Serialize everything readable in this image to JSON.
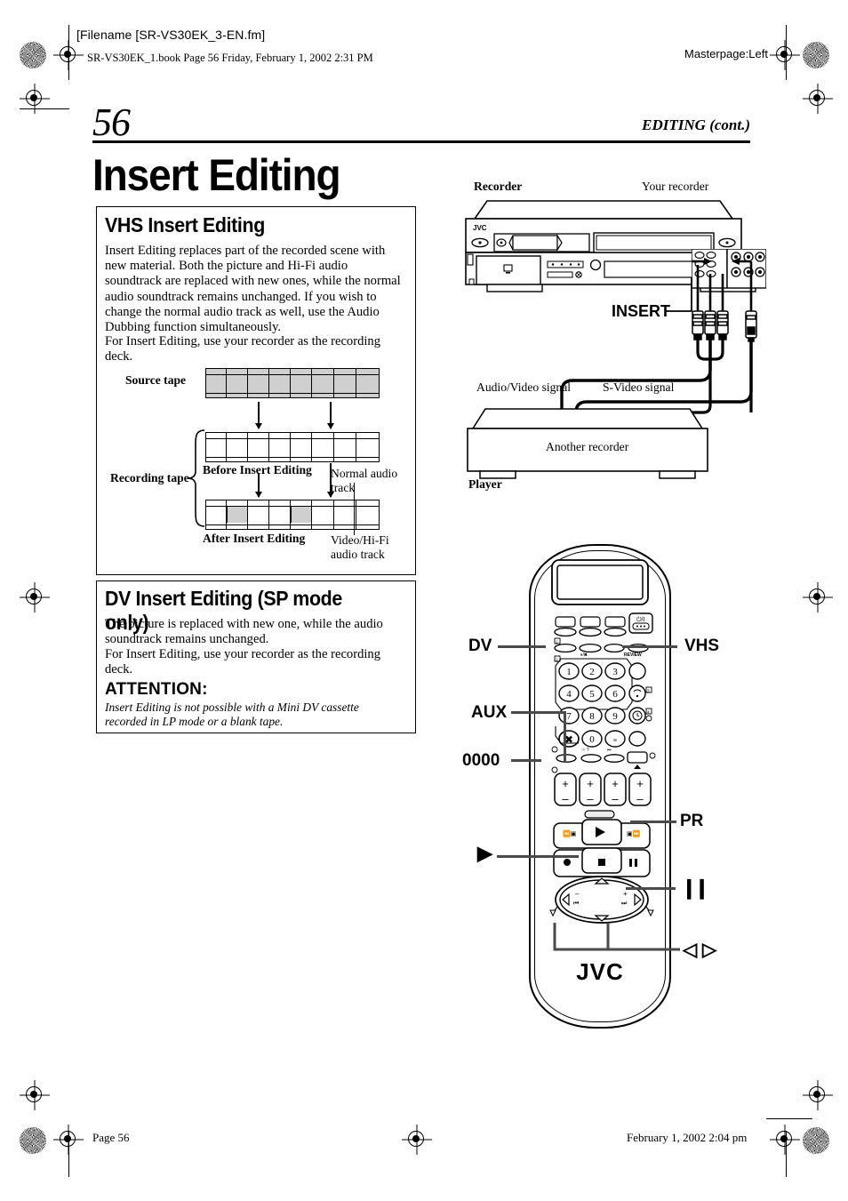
{
  "header": {
    "filename_line": "[Filename [SR-VS30EK_3-EN.fm]",
    "book_line": "SR-VS30EK_1.book  Page 56  Friday, February 1, 2002  2:31 PM",
    "masterpage": "Masterpage:Left"
  },
  "page": {
    "number": "56",
    "running_head": "EDITING (cont.)",
    "title": "Insert Editing"
  },
  "vhs_section": {
    "heading": "VHS Insert Editing",
    "paragraph": "Insert Editing replaces part of the recorded scene with new material. Both the picture and Hi-Fi audio soundtrack are replaced with new ones, while the normal audio soundtrack remains unchanged. If you wish to change the normal audio track as well, use the Audio Dubbing function simultaneously.",
    "paragraph2": "For Insert Editing, use your recorder as the recording deck."
  },
  "tape_diagram": {
    "source_tape_label": "Source tape",
    "recording_tape_label": "Recording tape",
    "before_label": "Before Insert Editing",
    "after_label": "After Insert Editing",
    "normal_audio_label_line1": "Normal audio",
    "normal_audio_label_line2": "track",
    "video_hifi_label_line1": "Video/Hi-Fi",
    "video_hifi_label_line2": "audio track",
    "source_cells_shaded": [
      true,
      true,
      true,
      true,
      true,
      true,
      true,
      true
    ],
    "before_cells_shaded": [
      false,
      false,
      false,
      false,
      false,
      false,
      false,
      false
    ],
    "after_cells_shaded": [
      false,
      true,
      false,
      false,
      true,
      false,
      false,
      false
    ]
  },
  "dv_section": {
    "heading": "DV Insert Editing (SP mode only)",
    "paragraph": "The picture is replaced with new one, while the audio soundtrack remains unchanged.",
    "paragraph2": "For Insert Editing, use your recorder as the recording deck.",
    "attention_heading": "ATTENTION:",
    "attention_body": "Insert Editing is not possible with a Mini DV cassette recorded in LP mode or a blank tape."
  },
  "connection_diagram": {
    "recorder_label": "Recorder",
    "your_recorder_label": "Your recorder",
    "brand": "JVC",
    "insert_label": "INSERT",
    "av_signal_label": "Audio/Video signal",
    "svideo_signal_label": "S-Video signal",
    "another_recorder_label": "Another recorder",
    "player_label": "Player"
  },
  "remote": {
    "brand": "JVC",
    "power_glyph": "⏻/I",
    "numbers": [
      "1",
      "2",
      "3",
      "4",
      "5",
      "6",
      "7",
      "8",
      "9",
      "0"
    ],
    "cancel_glyph": "✕",
    "callouts": {
      "dv": "DV",
      "vhs": "VHS",
      "aux": "AUX",
      "zeros": "0000",
      "pr": "PR",
      "play": "▶",
      "pause": "❙❙",
      "left_right": "◁ ▷"
    },
    "review_label": "REVIEW",
    "plus": "+",
    "minus": "–"
  },
  "footer": {
    "left": "Page 56",
    "right": "February 1, 2002  2:04 pm"
  },
  "colors": {
    "ink": "#000000",
    "tape_shade": "#cfcfcf",
    "callout_line": "#4a4a4a"
  }
}
